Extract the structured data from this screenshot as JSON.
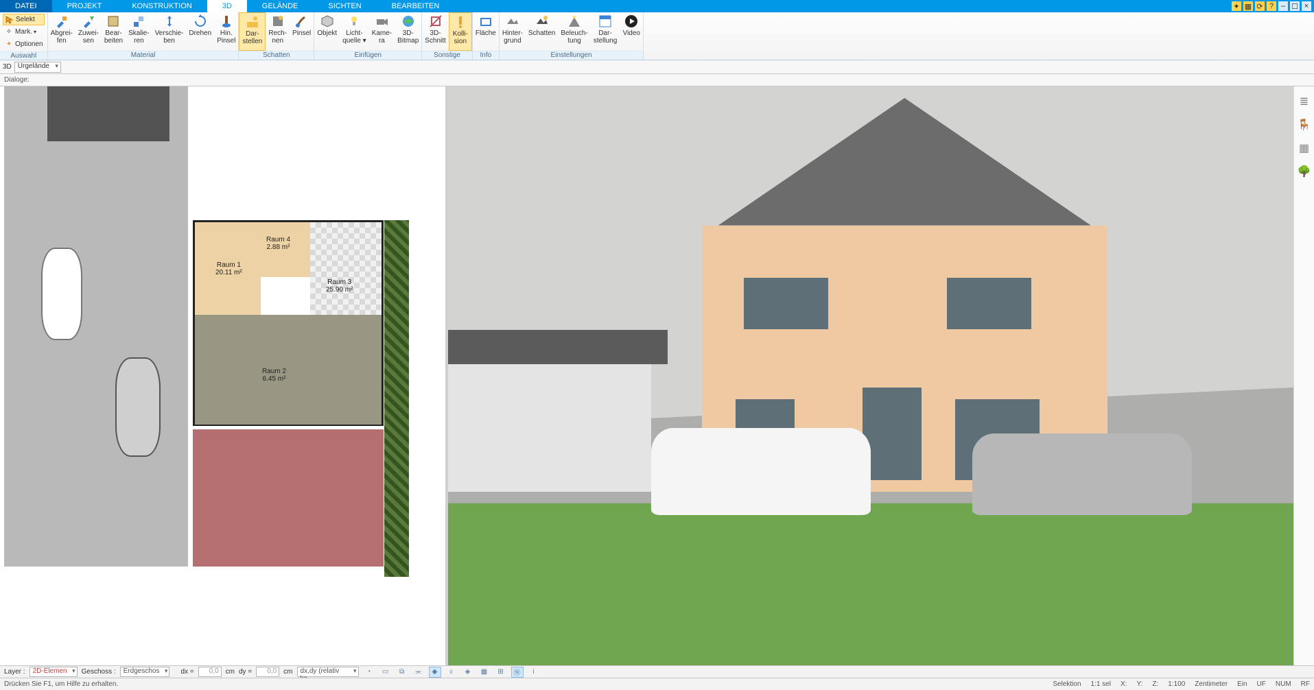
{
  "tabs": {
    "file": "DATEI",
    "projekt": "PROJEKT",
    "konstruktion": "KONSTRUKTION",
    "d3": "3D",
    "gelaende": "GELÄNDE",
    "sichten": "SICHTEN",
    "bearbeiten": "BEARBEITEN",
    "active": "d3"
  },
  "auswahl": {
    "selekt": "Selekt",
    "mark": "Mark.",
    "optionen": "Optionen",
    "group": "Auswahl"
  },
  "material": {
    "group": "Material",
    "btns": [
      {
        "id": "abgreifen",
        "l1": "Abgrei-",
        "l2": "fen"
      },
      {
        "id": "zuweisen",
        "l1": "Zuwei-",
        "l2": "sen"
      },
      {
        "id": "bearbeiten",
        "l1": "Bear-",
        "l2": "beiten"
      },
      {
        "id": "skalieren",
        "l1": "Skalie-",
        "l2": "ren"
      },
      {
        "id": "verschieben",
        "l1": "Verschie-",
        "l2": "ben"
      },
      {
        "id": "drehen",
        "l1": "Drehen",
        "l2": ""
      },
      {
        "id": "hinpunten",
        "l1": "Hin.",
        "l2": "Pinsel"
      }
    ]
  },
  "schatten": {
    "group": "Schatten",
    "btns": [
      {
        "id": "darstellen",
        "l1": "Dar-",
        "l2": "stellen"
      },
      {
        "id": "rechnen",
        "l1": "Rech-",
        "l2": "nen"
      },
      {
        "id": "pinsel",
        "l1": "Pinsel",
        "l2": ""
      }
    ]
  },
  "einfuegen": {
    "group": "Einfügen",
    "btns": [
      {
        "id": "objekt",
        "l1": "Objekt",
        "l2": ""
      },
      {
        "id": "lichtquelle",
        "l1": "Licht-",
        "l2": "quelle ▾"
      },
      {
        "id": "kamera",
        "l1": "Kame-",
        "l2": "ra"
      },
      {
        "id": "bitmap",
        "l1": "3D-",
        "l2": "Bitmap"
      }
    ]
  },
  "sonstige": {
    "group": "Sonstige",
    "btns": [
      {
        "id": "schnitt",
        "l1": "3D-",
        "l2": "Schnitt"
      },
      {
        "id": "kollision",
        "l1": "Kolli-",
        "l2": "sion"
      }
    ]
  },
  "info": {
    "group": "Info",
    "btns": [
      {
        "id": "flaeche",
        "l1": "Fläche",
        "l2": ""
      }
    ]
  },
  "einstellungen": {
    "group": "Einstellungen",
    "btns": [
      {
        "id": "hintergrund",
        "l1": "Hinter-",
        "l2": "grund"
      },
      {
        "id": "schatten2",
        "l1": "Schatten",
        "l2": ""
      },
      {
        "id": "beleuchtung",
        "l1": "Beleuch-",
        "l2": "tung"
      },
      {
        "id": "darstellung",
        "l1": "Dar-",
        "l2": "stellung"
      },
      {
        "id": "video",
        "l1": "Video",
        "l2": ""
      }
    ]
  },
  "viewbar": {
    "mode": "3D",
    "combo": "Urgelände"
  },
  "dlgbar": {
    "label": "Dialoge:"
  },
  "rooms": {
    "r1": {
      "name": "Raum 1",
      "area": "20.11 m²"
    },
    "r2": {
      "name": "Raum 2",
      "area": "6.45 m²"
    },
    "r3": {
      "name": "Raum 3",
      "area": "25.90 m²"
    },
    "r4": {
      "name": "Raum 4",
      "area": "2.88 m²"
    }
  },
  "bottombar": {
    "layer_label": "Layer :",
    "layer_value": "2D-Elemen",
    "geschoss_label": "Geschoss :",
    "geschoss_value": "Erdgeschos",
    "dx_label": "dx =",
    "dx_value": "0,0",
    "dy_label": "dy =",
    "dy_value": "0,0",
    "unit": "cm",
    "rel": "dx,dy (relativ ka"
  },
  "statusbar": {
    "help": "Drücken Sie F1, um Hilfe zu erhalten.",
    "cells": {
      "sel": "Selektion",
      "ratio": "1:1 sel",
      "x": "X:",
      "y": "Y:",
      "z": "Z:",
      "scale": "1:100",
      "unit": "Zentimeter",
      "ein": "Ein",
      "uf": "UF",
      "num": "NUM",
      "rf": "RF"
    }
  }
}
